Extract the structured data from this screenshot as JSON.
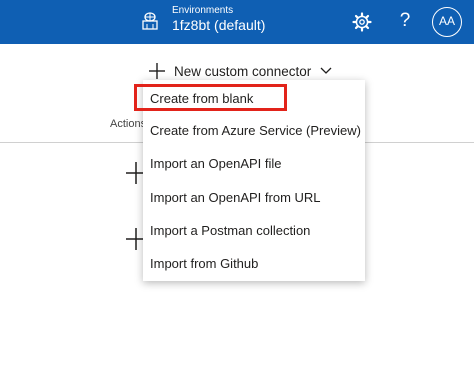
{
  "header": {
    "env_label": "Environments",
    "env_name": "1fz8bt (default)",
    "env_icon": "globe-building-icon",
    "settings_icon": "gear-icon",
    "help_label": "?",
    "avatar_initials": "AA",
    "bar_color": "#0f5fb3"
  },
  "toolbar": {
    "new_connector_label": "New custom connector",
    "plus_icon": "plus-icon",
    "chevron_icon": "chevron-down-icon"
  },
  "table": {
    "actions_header": "Actions"
  },
  "menu": {
    "items": [
      "Create from blank",
      "Create from Azure Service (Preview)",
      "Import an OpenAPI file",
      "Import an OpenAPI from URL",
      "Import a Postman collection",
      "Import from Github"
    ],
    "highlighted_item": "Create from blank",
    "highlight_color": "#e2231a"
  }
}
